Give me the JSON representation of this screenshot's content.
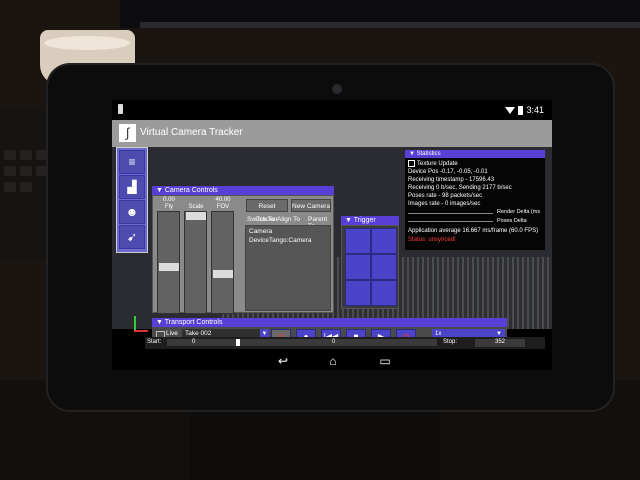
{
  "statusbar": {
    "time": "3:41"
  },
  "app": {
    "title": "Virtual Camera Tracker"
  },
  "toolbar": {
    "icons": [
      "list-icon",
      "stairs-icon",
      "owl-icon",
      "pointer-gear-icon"
    ]
  },
  "camera_controls": {
    "header": "▼ Camera Controls",
    "columns": [
      {
        "value": "0.00",
        "label": "Fly"
      },
      {
        "value": "",
        "label": "Scale"
      },
      {
        "value": "40.00",
        "label": "FOV"
      }
    ],
    "handle_levels": [
      0.55,
      0.0,
      0.62
    ],
    "buttons": {
      "reset": "Reset Tracker",
      "new": "New Camera"
    },
    "tabs": {
      "switch": "Switch To",
      "align": "Align To",
      "parent": "Parent To"
    },
    "list": [
      "Camera",
      "DeviceTango:Camera"
    ]
  },
  "trigger_controls": {
    "header": "▼ Trigger Controls"
  },
  "statistics": {
    "header": "▼ Statistics",
    "texture_update": "Texture Update",
    "lines": [
      "Device Pos -0.17, -0.05, -0.01",
      "Receiving timestamp - 17596.43",
      "Receiving 0 b/sec, Sending 2177 b/sec",
      "Poses rate - 98 packets/sec",
      "Images rate - 0 images/sec"
    ],
    "render_delta": "Render Delta (ms",
    "poses_delta": "Poses Delta",
    "app_average": "Application average 16.667 ms/frame (60.0 FPS)",
    "status": "Status: unsynced!"
  },
  "transport": {
    "header": "▼ Transport Controls",
    "live": "Live",
    "take": "Take 002",
    "speed": "1x",
    "start_label": "Start:",
    "start_value": "0",
    "mid_value": "0",
    "stop_label": "Stop:",
    "stop_value": "352",
    "playhead": 0.26
  },
  "colors": {
    "accent": "#5a3fd6",
    "button": "#4b44c9",
    "status_error": "#ff3a3a"
  }
}
